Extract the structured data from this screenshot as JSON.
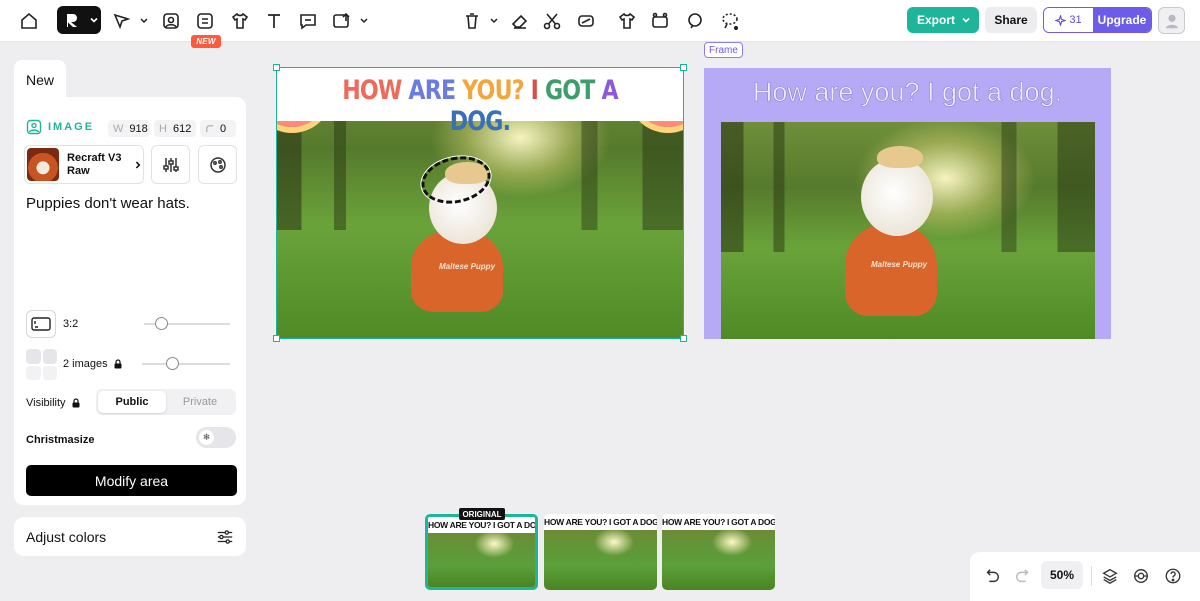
{
  "toolbar": {
    "badge_new": "NEW",
    "export_label": "Export",
    "share_label": "Share",
    "credits_count": "31",
    "upgrade_label": "Upgrade"
  },
  "panel": {
    "tab_new": "New",
    "image_label": "IMAGE",
    "width_key": "W",
    "width_value": "918",
    "height_key": "H",
    "height_value": "612",
    "rotation_value": "0",
    "model_name": "Recraft V3 Raw",
    "prompt": "Puppies don't wear hats.",
    "aspect_ratio": "3:2",
    "aspect_slider_value": 0.2,
    "images_count": "2 images",
    "images_slider_value": 0.35,
    "visibility_label": "Visibility",
    "visibility_options": [
      "Public",
      "Private"
    ],
    "visibility_selected": "Public",
    "christmasize_label": "Christmasize",
    "modify_button": "Modify area",
    "adjust_colors": "Adjust colors"
  },
  "canvas": {
    "artwork_title_words": [
      {
        "t": "HOW ",
        "c": "#ee6a5a"
      },
      {
        "t": "ARE ",
        "c": "#6b7be0"
      },
      {
        "t": "YOU? ",
        "c": "#f2a63b"
      },
      {
        "t": "I ",
        "c": "#d94c4c"
      },
      {
        "t": "GOT ",
        "c": "#3f9c6b"
      },
      {
        "t": "A ",
        "c": "#8c5ad8"
      },
      {
        "t": "DOG.",
        "c": "#3b6fb6"
      }
    ],
    "shirt_text": "Maltese Puppy",
    "frame_label": "Frame",
    "frame_title": "How are you? I got a dog."
  },
  "thumbnails": {
    "original_badge": "ORIGINAL",
    "title": "HOW ARE YOU? I GOT A DOG.",
    "count": 3
  },
  "zoom": {
    "value": "50%"
  },
  "colors": {
    "accent": "#1fb59a",
    "brand_purple": "#6c5ce7",
    "frame_bg": "#b6a9f6"
  }
}
